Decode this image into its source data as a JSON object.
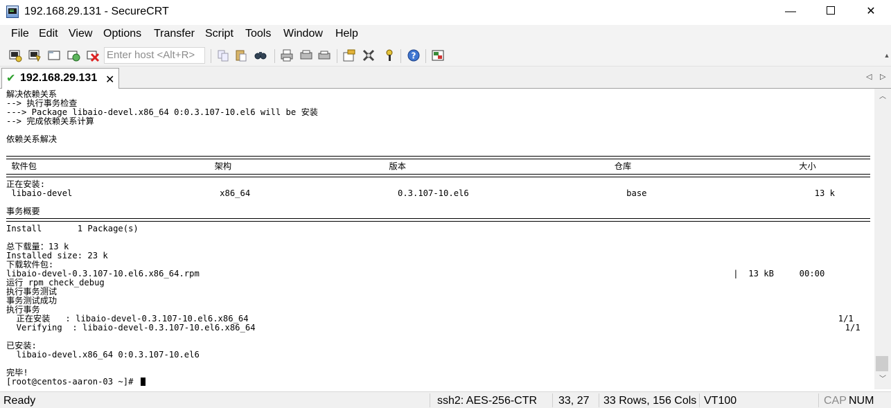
{
  "window": {
    "title": "192.168.29.131 - SecureCRT",
    "minimize": "—",
    "close": "✕"
  },
  "menu": [
    "File",
    "Edit",
    "View",
    "Options",
    "Transfer",
    "Script",
    "Tools",
    "Window",
    "Help"
  ],
  "toolbar": {
    "host_placeholder": "Enter host <Alt+R>",
    "icons": [
      "connect-icon",
      "quick-connect-icon",
      "connect-in-tab-icon",
      "reconnect-icon",
      "disconnect-icon",
      "copy-icon",
      "paste-icon",
      "find-icon",
      "print-icon",
      "print-setup-icon",
      "print-screen-icon",
      "session-options-icon",
      "global-options-icon",
      "keymap-icon",
      "help-icon",
      "sftp-icon"
    ]
  },
  "tab": {
    "label": "192.168.29.131",
    "status_icon": "check-icon",
    "close": "✕"
  },
  "terminal": {
    "lines": [
      "解决依赖关系",
      "--> 执行事务检查",
      "---> Package libaio-devel.x86_64 0:0.3.107-10.el6 will be 安装",
      "--> 完成依赖关系计算",
      "",
      "依赖关系解决",
      "",
      "",
      " 软件包                                   架构                               版本                                         仓库                                 大小",
      "",
      "正在安装:",
      " libaio-devel                             x86_64                             0.3.107-10.el6                               base                                 13 k",
      "",
      "事务概要",
      "",
      "Install       1 Package(s)",
      "",
      "总下载量：13 k",
      "Installed size: 23 k",
      "下载软件包:",
      "libaio-devel-0.3.107-10.el6.x86_64.rpm                                                                                                         |  13 kB     00:00",
      "运行 rpm_check_debug",
      "执行事务测试",
      "事务测试成功",
      "执行事务",
      "  正在安装   : libaio-devel-0.3.107-10.el6.x86_64                                                                                                                    1/1",
      "  Verifying  : libaio-devel-0.3.107-10.el6.x86_64                                                                                                                    1/1",
      "",
      "已安装:",
      "  libaio-devel.x86_64 0:0.3.107-10.el6",
      "",
      "完毕!",
      "[root@centos-aaron-03 ~]# "
    ]
  },
  "status": {
    "ready": "Ready",
    "cipher": "ssh2: AES-256-CTR",
    "cursor_pos": "33,  27",
    "size": "33 Rows, 156 Cols",
    "emulation": "VT100",
    "cap": "CAP",
    "num": "NUM"
  },
  "colors": {
    "check": "#2da02d",
    "chrome": "#f0f0f0",
    "terminal_bg": "#ffffff"
  }
}
